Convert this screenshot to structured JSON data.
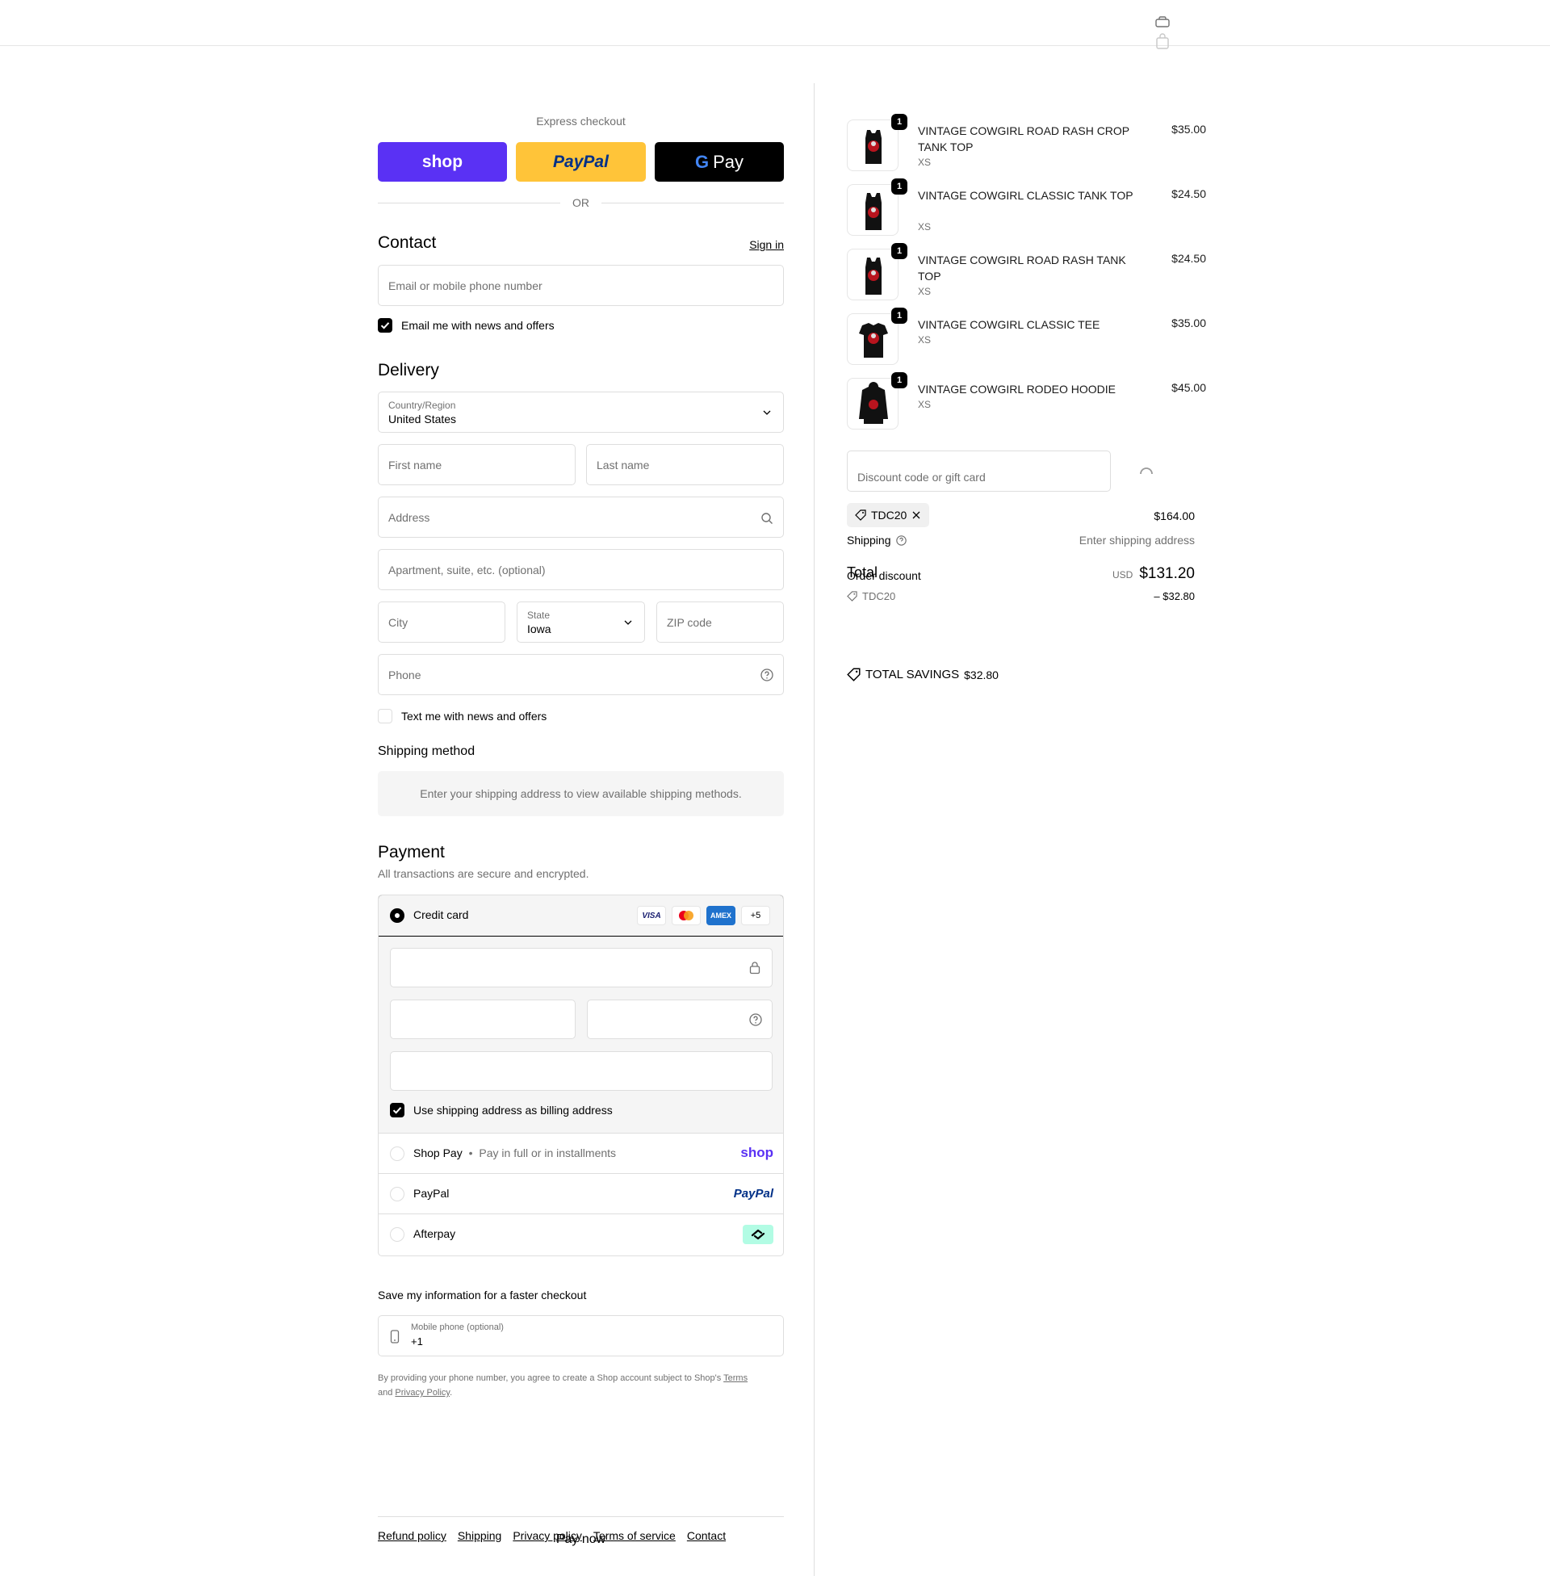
{
  "header": {
    "account_icon": "account-icon",
    "bag_icon": "shopping-bag-icon"
  },
  "express": {
    "title": "Express checkout",
    "shop_label": "shop",
    "paypal_label": "PayPal",
    "gpay_label": "Pay",
    "or_label": "OR",
    "shop_color": "#5a31f4",
    "paypal_color": "#ffc439",
    "gpay_color": "#000000"
  },
  "contact": {
    "title": "Contact",
    "sign_in": "Sign in",
    "email_placeholder": "Email or mobile phone number",
    "news_label": "Email me with news and offers",
    "news_checked": true
  },
  "delivery": {
    "title": "Delivery",
    "country_label": "Country/Region",
    "country_value": "United States",
    "first_name": "First name",
    "last_name": "Last name",
    "address": "Address",
    "apartment": "Apartment, suite, etc. (optional)",
    "city": "City",
    "state_label": "State",
    "state_value": "Iowa",
    "zip": "ZIP code",
    "phone": "Phone",
    "text_label": "Text me with news and offers",
    "text_checked": false
  },
  "shipping_method": {
    "title": "Shipping method",
    "notice": "Enter your shipping address to view available shipping methods."
  },
  "payment": {
    "title": "Payment",
    "subtitle": "All transactions are secure and encrypted.",
    "credit_card": "Credit card",
    "cards": [
      "VISA",
      "mastercard",
      "AMEX",
      "+5"
    ],
    "billing_label": "Use shipping address as billing address",
    "billing_checked": true,
    "shop_pay": "Shop Pay",
    "shop_pay_sub": "Pay in full or in installments",
    "shop_pay_logo": "shop",
    "paypal": "PayPal",
    "paypal_logo": "PayPal",
    "afterpay": "Afterpay",
    "afterpay_color": "#b2fce4"
  },
  "save_info": {
    "title": "Save my information for a faster checkout",
    "mobile_label": "Mobile phone (optional)",
    "mobile_value": "+1",
    "disclaimer_1": "By providing your phone number, you agree to create a Shop account subject to Shop's",
    "terms": "Terms",
    "and": "and",
    "privacy": "Privacy Policy",
    "period": "."
  },
  "pay_now": "Pay now",
  "footer": {
    "links": [
      "Refund policy",
      "Shipping",
      "Privacy policy",
      "Terms of service",
      "Contact"
    ]
  },
  "cart": {
    "items": [
      {
        "name": "VINTAGE COWGIRL ROAD RASH CROP TANK TOP",
        "variant": "XS",
        "price": "$35.00",
        "qty": "1"
      },
      {
        "name": "VINTAGE COWGIRL CLASSIC TANK TOP",
        "variant": "XS",
        "price": "$24.50",
        "qty": "1"
      },
      {
        "name": "VINTAGE COWGIRL ROAD RASH TANK TOP",
        "variant": "XS",
        "price": "$24.50",
        "qty": "1"
      },
      {
        "name": "VINTAGE COWGIRL CLASSIC TEE",
        "variant": "XS",
        "price": "$35.00",
        "qty": "1"
      },
      {
        "name": "VINTAGE COWGIRL RODEO HOODIE",
        "variant": "XS",
        "price": "$45.00",
        "qty": "1"
      }
    ],
    "discount_placeholder": "Discount code or gift card",
    "code_tag": "TDC20",
    "subtotal_value": "$164.00",
    "shipping_label": "Shipping",
    "shipping_value": "Enter shipping address",
    "total_label": "Total",
    "order_discount_label": "Order discount",
    "currency": "USD",
    "total_value": "$131.20",
    "discount_code": "TDC20",
    "discount_value": "– $32.80",
    "savings_label": "TOTAL SAVINGS",
    "savings_value": "$32.80"
  }
}
